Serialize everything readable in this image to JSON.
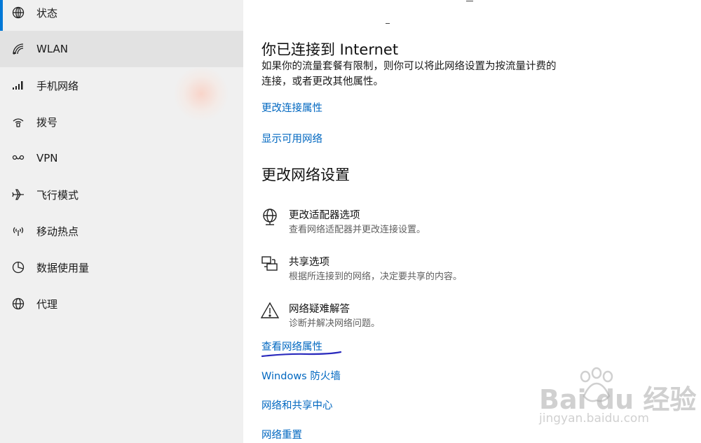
{
  "sidebar": {
    "items": [
      {
        "label": "状态",
        "icon": "globe-icon"
      },
      {
        "label": "WLAN",
        "icon": "wifi-icon"
      },
      {
        "label": "手机网络",
        "icon": "signal-bars-icon"
      },
      {
        "label": "拨号",
        "icon": "dialup-icon"
      },
      {
        "label": "VPN",
        "icon": "vpn-icon"
      },
      {
        "label": "飞行模式",
        "icon": "airplane-icon"
      },
      {
        "label": "移动热点",
        "icon": "hotspot-icon"
      },
      {
        "label": "数据使用量",
        "icon": "pie-chart-icon"
      },
      {
        "label": "代理",
        "icon": "globe-icon"
      }
    ],
    "selected_label": "WLAN"
  },
  "main": {
    "status_heading": "你已连接到 Internet",
    "status_desc_line1": "如果你的流量套餐有限制，则你可以将此网络设置为按流量计费的",
    "status_desc_line2": "连接，或者更改其他属性。",
    "link_change_connection": "更改连接属性",
    "link_show_networks": "显示可用网络",
    "section_heading": "更改网络设置",
    "options": [
      {
        "title": "更改适配器选项",
        "desc": "查看网络适配器并更改连接设置。",
        "icon": "adapter-globe-icon"
      },
      {
        "title": "共享选项",
        "desc": "根据所连接到的网络，决定要共享的内容。",
        "icon": "sharing-icon"
      },
      {
        "title": "网络疑难解答",
        "desc": "诊断并解决网络问题。",
        "icon": "warning-icon"
      }
    ],
    "links": [
      "查看网络属性",
      "Windows 防火墙",
      "网络和共享中心",
      "网络重置"
    ]
  },
  "colors": {
    "accent": "#0078d7",
    "link": "#0067c0",
    "sidebar_bg": "#f0f0f0",
    "selected_bg": "#e2e2e2",
    "underline_annotation": "#2b2bbd"
  },
  "watermark": {
    "logo_text": "Bai du 经验",
    "url": "jingyan.baidu.com"
  }
}
